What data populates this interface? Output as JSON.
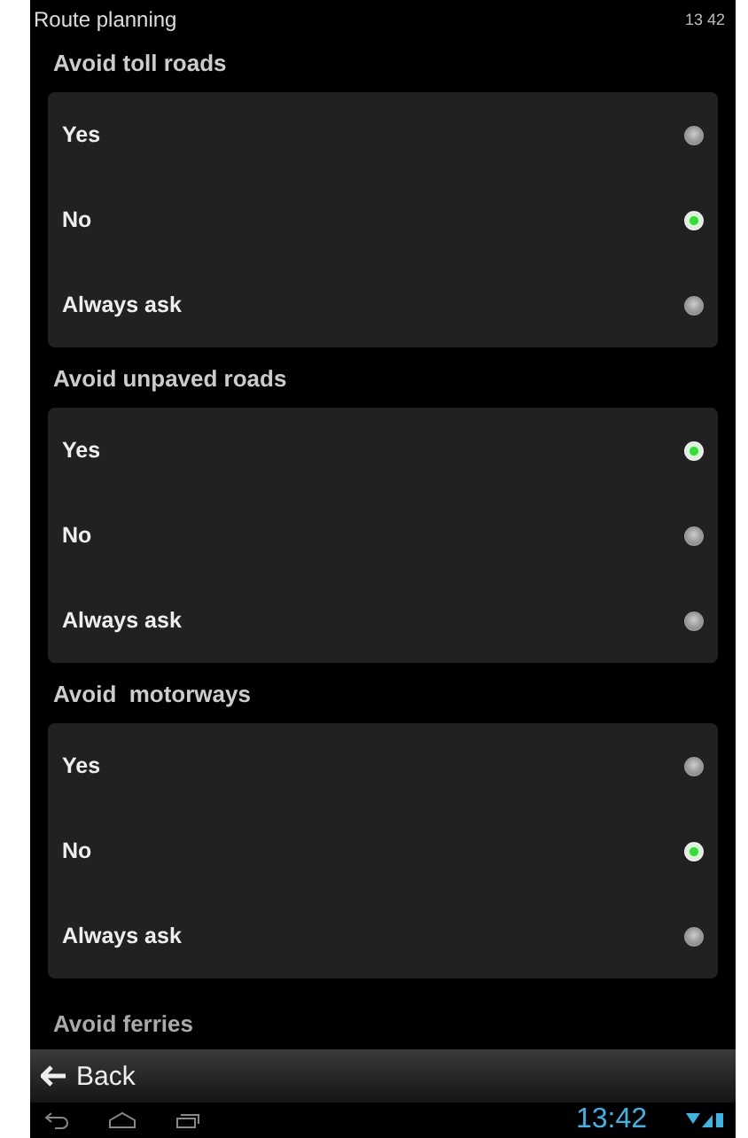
{
  "window": {
    "title": "Route planning",
    "status_time": "13 42"
  },
  "sections": [
    {
      "title": "Avoid toll roads",
      "options": [
        {
          "label": "Yes",
          "selected": false
        },
        {
          "label": "No",
          "selected": true
        },
        {
          "label": "Always ask",
          "selected": false
        }
      ]
    },
    {
      "title": "Avoid unpaved roads",
      "options": [
        {
          "label": "Yes",
          "selected": true
        },
        {
          "label": "No",
          "selected": false
        },
        {
          "label": "Always ask",
          "selected": false
        }
      ]
    },
    {
      "title": "Avoid  motorways",
      "options": [
        {
          "label": "Yes",
          "selected": false
        },
        {
          "label": "No",
          "selected": true
        },
        {
          "label": "Always ask",
          "selected": false
        }
      ]
    }
  ],
  "cut_section": "Avoid ferries",
  "back": {
    "label": "Back"
  },
  "system_bar": {
    "clock": "13:42"
  }
}
